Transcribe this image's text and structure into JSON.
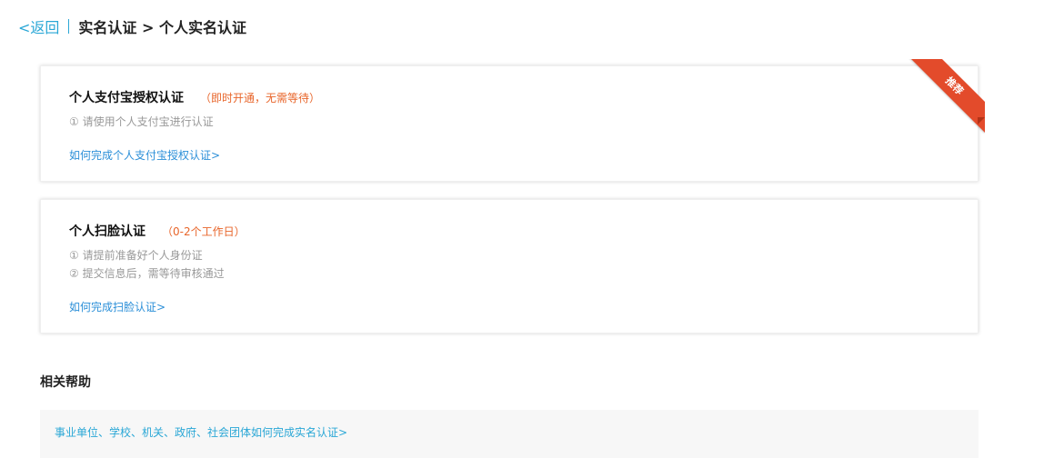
{
  "header": {
    "back_label": "<返回",
    "breadcrumb": "实名认证 > 个人实名认证"
  },
  "cards": [
    {
      "title": "个人支付宝授权认证",
      "hint": "（即时开通，无需等待）",
      "steps": [
        "① 请使用个人支付宝进行认证"
      ],
      "link": "如何完成个人支付宝授权认证>",
      "ribbon": "推荐"
    },
    {
      "title": "个人扫脸认证",
      "hint": "（0-2个工作日）",
      "steps": [
        "① 请提前准备好个人身份证",
        "② 提交信息后，需等待审核通过"
      ],
      "link": "如何完成扫脸认证>"
    }
  ],
  "help": {
    "heading": "相关帮助",
    "link": "事业单位、学校、机关、政府、社会团体如何完成实名认证>"
  },
  "colors": {
    "accent": "#2aa7d6",
    "link": "#2b8fd8",
    "hint": "#e8652a",
    "ribbon": "#e34b2b"
  }
}
